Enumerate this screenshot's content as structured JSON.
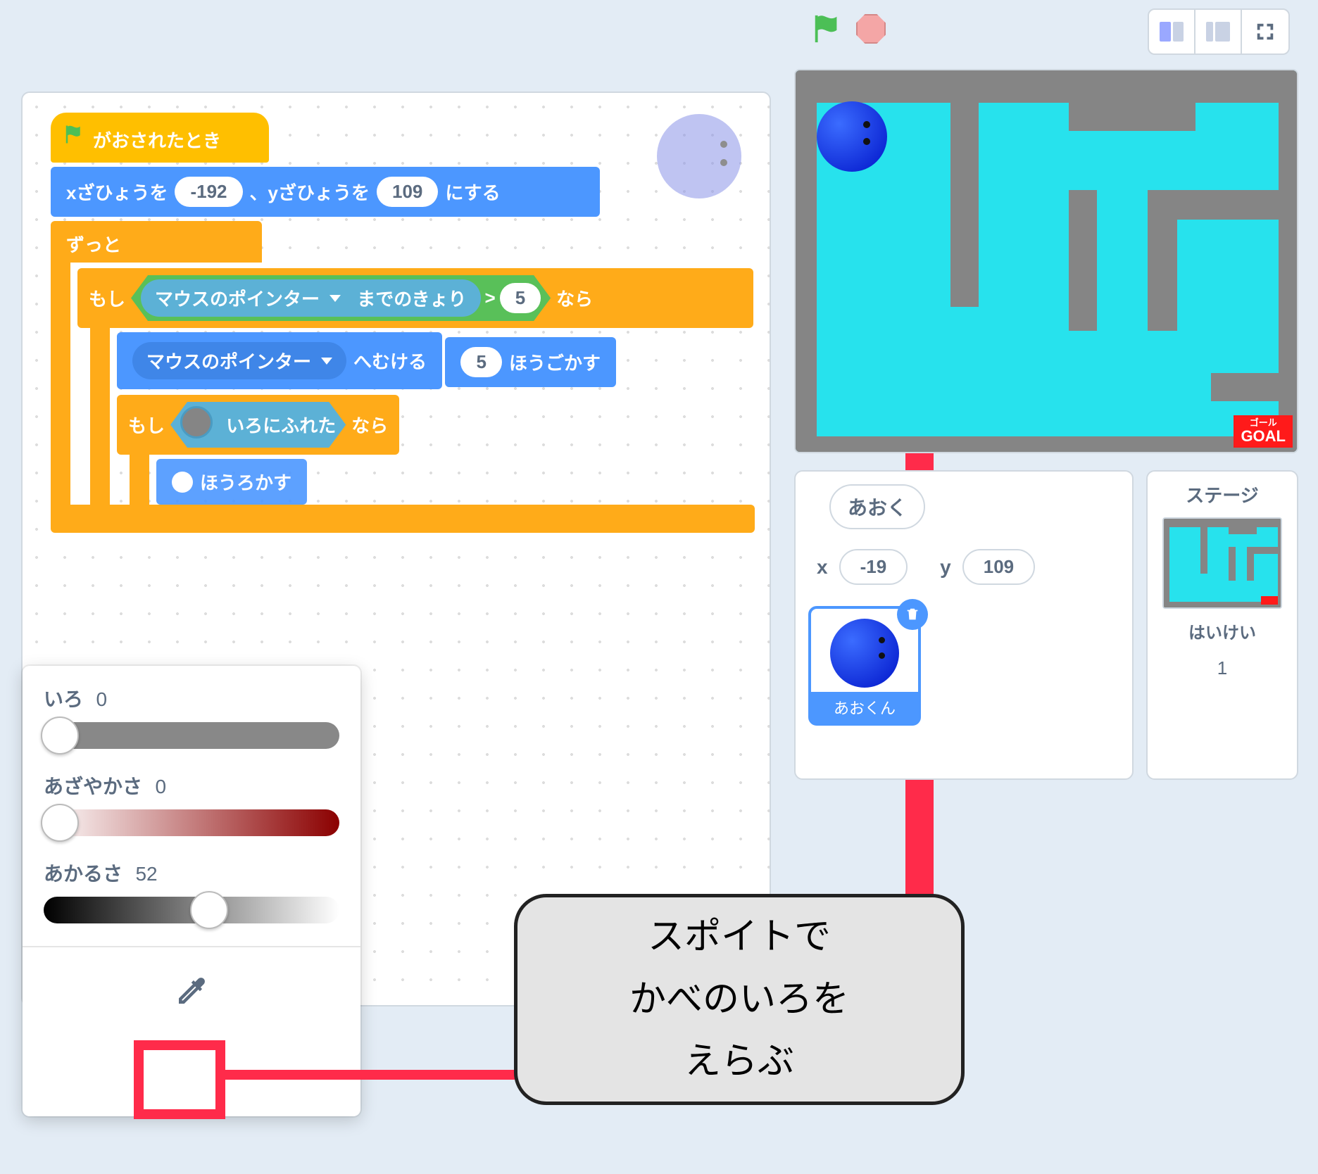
{
  "blocks": {
    "hat": "がおされたとき",
    "goto_x_label": "xざひょうを",
    "goto_y_label": "、yざひょうを",
    "goto_suffix": "にする",
    "goto_x": "-192",
    "goto_y": "109",
    "forever": "ずっと",
    "if": "もし",
    "then": "なら",
    "mouse_pointer": "マウスのポインター",
    "distance_to": "までのきょり",
    "gt": ">",
    "gt_val": "5",
    "point_towards": "へむける",
    "move_val": "5",
    "move_suffix": "ほうごかす",
    "touching_color": "いろにふれた",
    "partial": "ほうろかす"
  },
  "picker": {
    "hue_label": "いろ",
    "hue_val": "0",
    "sat_label": "あざやかさ",
    "sat_val": "0",
    "bri_label": "あかるさ",
    "bri_val": "52"
  },
  "callout": {
    "line1": "スポイトで",
    "line2": "かべのいろを",
    "line3": "えらぶ"
  },
  "sprite_info": {
    "name": "あおく",
    "x_label": "x",
    "x": "-19",
    "y_label": "y",
    "y": "109",
    "item_name": "あおくん"
  },
  "stage_panel": {
    "title": "ステージ",
    "backdrop_label": "はいけい",
    "backdrop_count": "1"
  },
  "goal": {
    "small": "ゴール",
    "big": "GOAL"
  }
}
